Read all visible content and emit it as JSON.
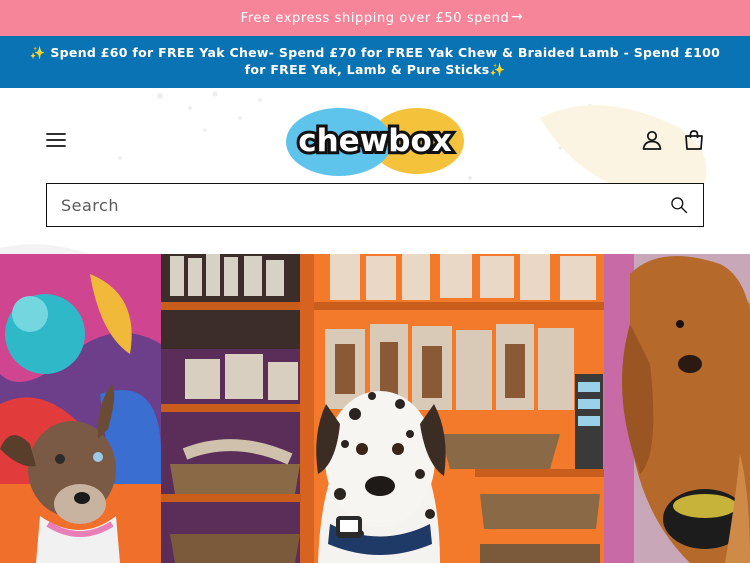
{
  "announcement": {
    "text": "Free express shipping over £50 spend",
    "arrow": "→"
  },
  "promo": {
    "text": "✨ Spend £60 for FREE Yak Chew- Spend £70 for FREE Yak Chew & Braided Lamb - Spend £100 for FREE Yak, Lamb & Pure Sticks✨"
  },
  "header": {
    "logo_text": "chewbox",
    "icons": {
      "menu": "hamburger-menu-icon",
      "account": "user-icon",
      "cart": "shopping-bag-icon",
      "search": "search-icon"
    }
  },
  "search": {
    "placeholder": "Search"
  },
  "colors": {
    "announcement_bg": "#f7859a",
    "promo_bg": "#0a73b3",
    "logo_blue": "#5ec4ec",
    "logo_yellow": "#f5c33b",
    "shelf_orange": "#f37a2a"
  },
  "hero": {
    "panels": [
      "puppy-colorful-background",
      "dalmatian-in-treat-shop",
      "golden-puppy-eating"
    ]
  }
}
